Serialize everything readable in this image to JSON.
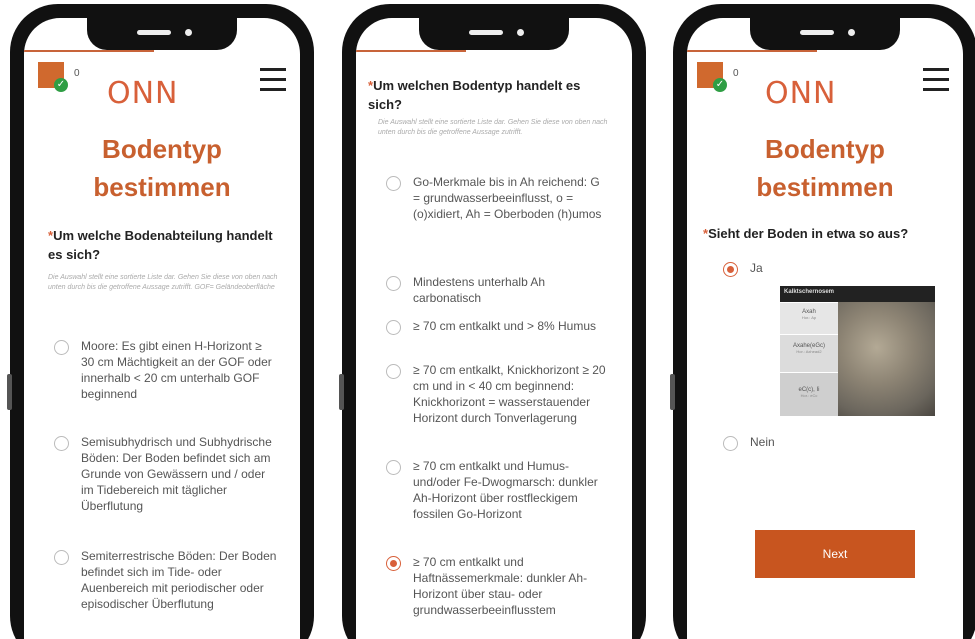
{
  "brand": {
    "logo_text": "ONN",
    "accent": "#d8603a",
    "title_color": "#c8602f",
    "button_color": "#c8551f"
  },
  "screen1": {
    "counter": "0",
    "title_line1": "Bodentyp",
    "title_line2": "bestimmen",
    "required_mark": "*",
    "question": "Um welche Bodenabteilung handelt es sich?",
    "hint": "Die Auswahl stellt eine sortierte Liste dar. Gehen Sie diese von oben nach unten durch bis die getroffene Aussage zutrifft. GOF= Geländeoberfläche",
    "options": [
      {
        "label": "Moore: Es gibt einen H-Horizont ≥ 30 cm Mächtigkeit an der GOF oder innerhalb < 20 cm unterhalb GOF beginnend",
        "checked": false
      },
      {
        "label": "Semisubhydrisch und Subhydrische Böden: Der Boden befindet sich am Grunde von Gewässern und / oder im Tidebereich mit täglicher Überflutung",
        "checked": false
      },
      {
        "label": "Semiterrestrische Böden: Der Boden befindet sich im Tide- oder Auenbereich mit periodischer oder episodischer Überflutung",
        "checked": false
      }
    ]
  },
  "screen2": {
    "required_mark": "*",
    "question": "Um welchen Bodentyp handelt es sich?",
    "hint": "Die Auswahl stellt eine sortierte Liste dar. Gehen Sie diese von oben nach unten durch bis die getroffene Aussage zutrifft.",
    "options": [
      {
        "label": "Go-Merkmale bis in Ah reichend: G = grundwasserbeeinflusst, o = (o)xidiert, Ah = Oberboden (h)umos",
        "checked": false
      },
      {
        "label": "Mindestens unterhalb Ah carbonatisch",
        "checked": false
      },
      {
        "label": "≥ 70 cm entkalkt und > 8% Humus",
        "checked": false
      },
      {
        "label": "≥ 70 cm entkalkt, Knickhorizont ≥ 20 cm und in < 40 cm beginnend: Knickhorizont = wasserstauender Horizont durch Tonverlagerung",
        "checked": false
      },
      {
        "label": "≥ 70 cm entkalkt und Humus- und/oder Fe-Dwogmarsch: dunkler Ah-Horizont über rostfleckigem fossilen Go-Horizont",
        "checked": false
      },
      {
        "label": "≥ 70 cm entkalkt und Haftnässemerkmale: dunkler Ah-Horizont über stau- oder grundwasserbeeinflusstem",
        "checked": true
      }
    ]
  },
  "screen3": {
    "counter": "0",
    "title_line1": "Bodentyp",
    "title_line2": "bestimmen",
    "required_mark": "*",
    "question": "Sieht der Boden in etwa so aus?",
    "option_yes": "Ja",
    "option_no": "Nein",
    "selected": "Ja",
    "soil_image": {
      "header": "Kalktschernosem",
      "layers": [
        {
          "name": "Axah",
          "sub": "Hor.: Ap"
        },
        {
          "name": "Axahe(eGc)",
          "sub": "Hor.: Axhead2"
        },
        {
          "name": "eC(c), Ii",
          "sub": "Hor.: eCc"
        }
      ]
    },
    "next_label": "Next"
  }
}
